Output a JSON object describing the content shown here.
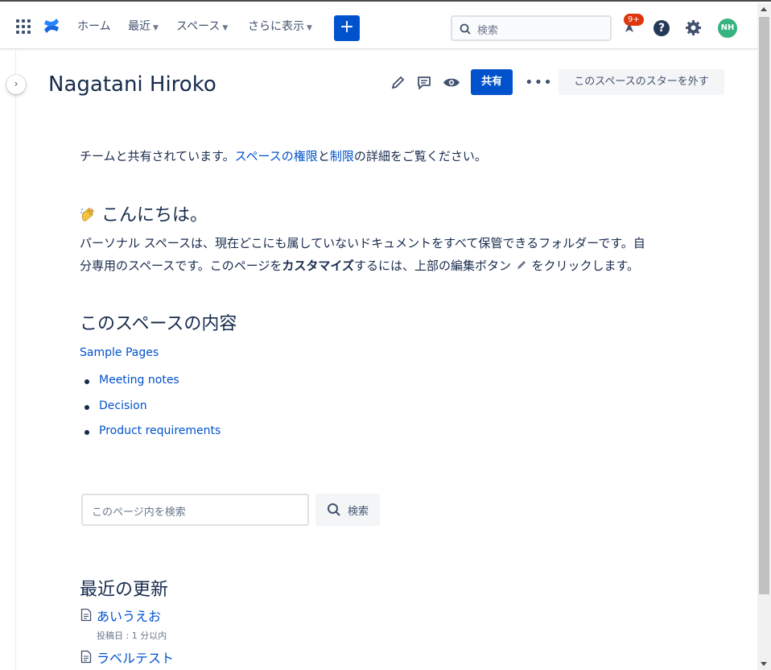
{
  "nav": {
    "home": "ホーム",
    "recent": "最近",
    "spaces": "スペース",
    "more": "さらに表示",
    "create": "+",
    "search_placeholder": "検索",
    "badge": "9+",
    "help": "?",
    "avatar": "NH"
  },
  "header": {
    "title": "Nagatani Hiroko",
    "share": "共有",
    "more": "•••",
    "unstar": "このスペースのスターを外す"
  },
  "content": {
    "shared_pre": "チームと共有されています。",
    "shared_link1": "スペースの権限",
    "shared_mid": "と",
    "shared_link2": "制限",
    "shared_post": "の詳細をご覧ください。",
    "greeting": "こんにちは。",
    "intro_line1": "パーソナル スペースは、現在どこにも属していないドキュメントをすべて保管できるフォルダーです。自",
    "intro_line2_pre": "分専用のスペースです。このページを",
    "intro_bold": "カスタマイズ",
    "intro_line2_post": "するには、上部の編集ボタン",
    "intro_line2_end": "をクリックします。",
    "contents_heading": "このスペースの内容",
    "page_tree_root": "Sample Pages",
    "page_tree_children": [
      "Meeting notes",
      "Decision",
      "Product requirements"
    ],
    "page_search_placeholder": "このページ内を検索",
    "page_search_button": "検索",
    "recent_heading": "最近の更新",
    "recent": [
      {
        "title": "あいうえお",
        "meta": "投稿日 : 1 分以内"
      },
      {
        "title": "ラベルテスト",
        "meta": ""
      }
    ]
  },
  "colors": {
    "brand": "#0052cc",
    "avatar": "#36b37e",
    "badge": "#de350b"
  }
}
